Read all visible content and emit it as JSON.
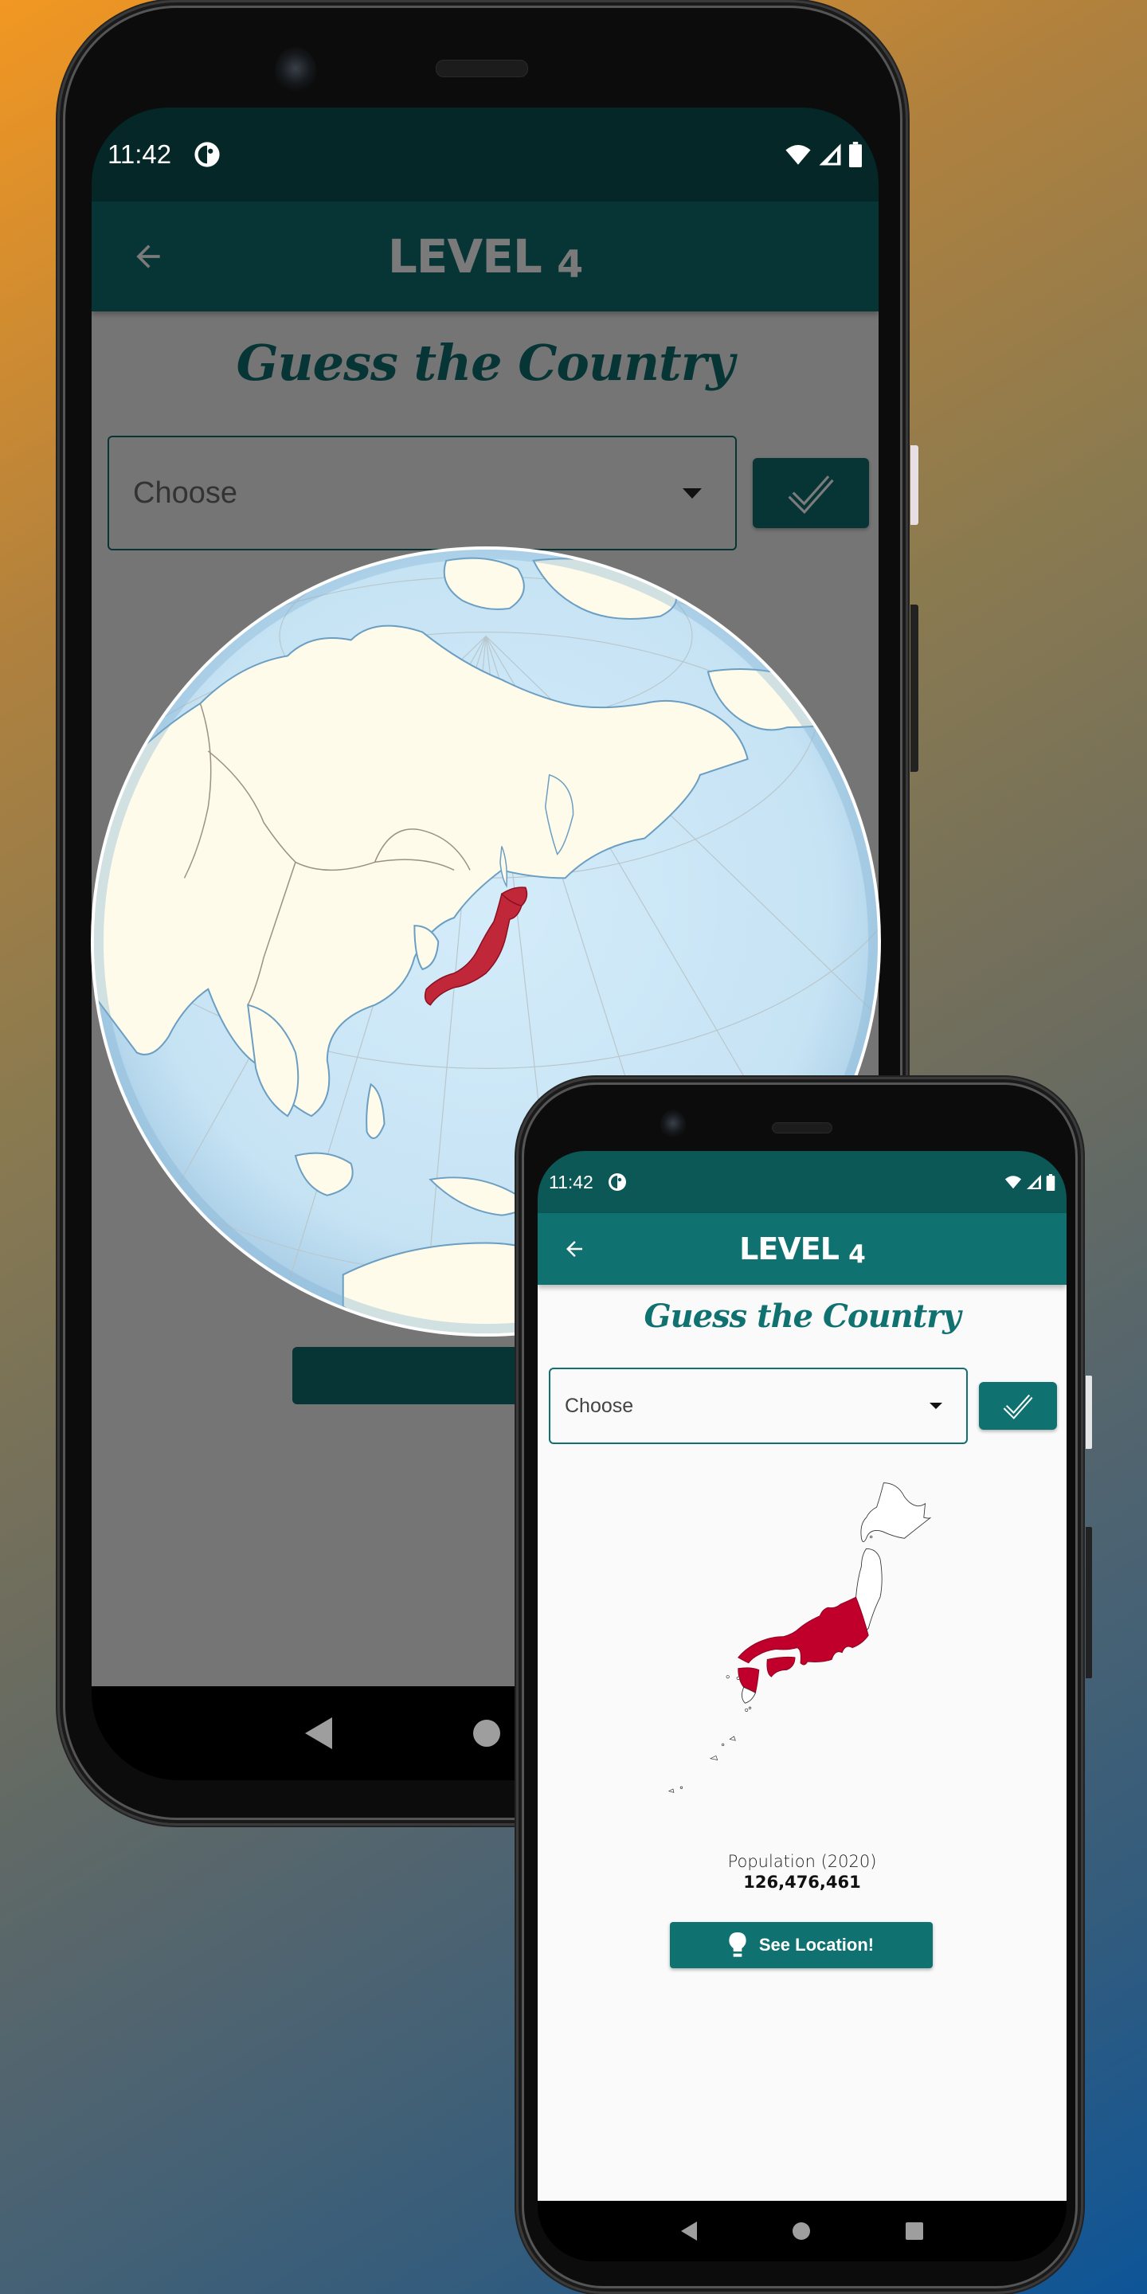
{
  "background": {
    "gradient_colors": [
      "#f29722",
      "#8a7a50",
      "#0d5598"
    ]
  },
  "big_phone": {
    "statusbar": {
      "time": "11:42",
      "icons": [
        "dnd-icon",
        "wifi-icon",
        "signal-icon",
        "battery-icon"
      ]
    },
    "appbar": {
      "back_icon": "arrow-left-icon",
      "title_word": "LEVEL",
      "title_number": "4"
    },
    "heading": "Guess the Country",
    "dropdown": {
      "placeholder": "Choose"
    },
    "check_button": {
      "icon": "check-icon"
    },
    "overlay": {
      "state": "dimmed",
      "globe_highlight": "Japan",
      "highlight_color": "#c0283a"
    },
    "navbar": {
      "buttons": [
        "back",
        "home",
        "recents"
      ]
    },
    "colors": {
      "appbar": "#073536",
      "statusbar": "#052727",
      "dim": "#757575"
    }
  },
  "small_phone": {
    "statusbar": {
      "time": "11:42",
      "icons": [
        "dnd-icon",
        "wifi-icon",
        "signal-icon",
        "battery-icon"
      ]
    },
    "appbar": {
      "back_icon": "arrow-left-icon",
      "title_word": "LEVEL",
      "title_number": "4"
    },
    "heading": "Guess the Country",
    "dropdown": {
      "placeholder": "Choose"
    },
    "check_button": {
      "icon": "check-icon"
    },
    "country_map": {
      "country": "Japan",
      "highlight_color": "#c0002a"
    },
    "population": {
      "label": "Population (2020)",
      "value": "126,476,461"
    },
    "see_location_button": {
      "label": "See Location!",
      "icon": "lightbulb-icon"
    },
    "navbar": {
      "buttons": [
        "back",
        "home",
        "recents"
      ]
    },
    "colors": {
      "appbar": "#0f7170",
      "statusbar": "#0b5857",
      "background": "#fafafa"
    }
  }
}
